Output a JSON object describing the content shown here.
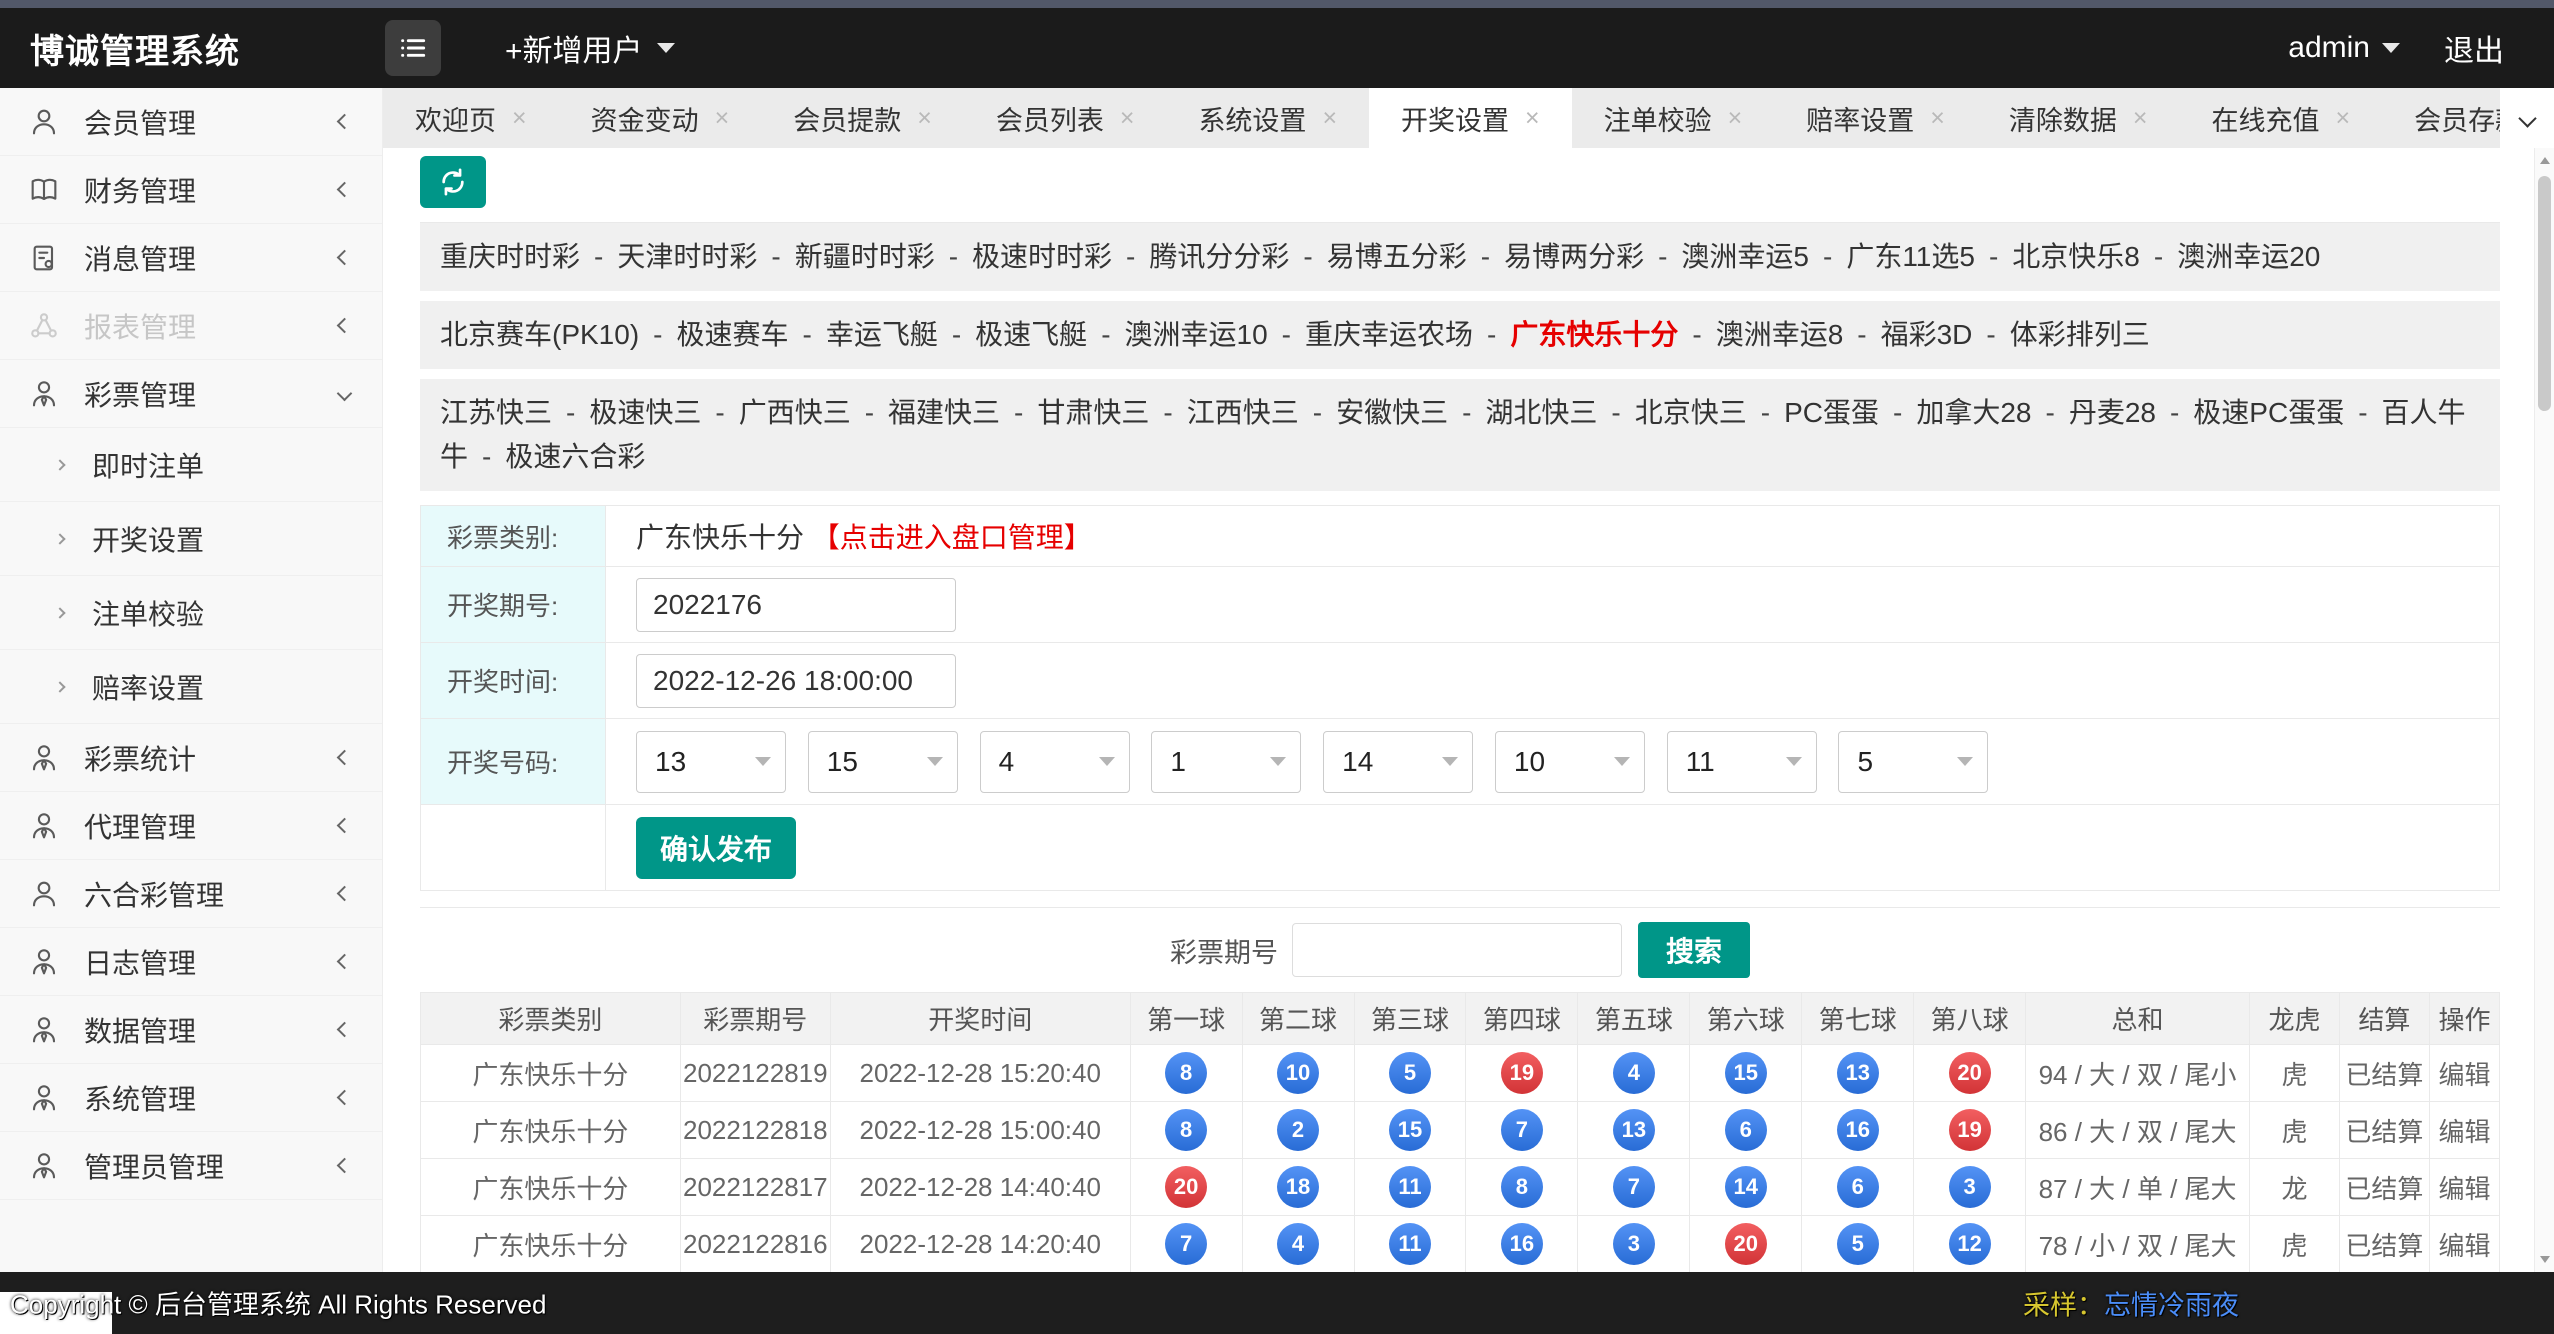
{
  "topbar": {
    "title": "博诚管理系统",
    "add_user": "+新增用户",
    "username": "admin",
    "logout": "退出"
  },
  "tabs": {
    "items": [
      "欢迎页",
      "资金变动",
      "会员提款",
      "会员列表",
      "系统设置",
      "开奖设置",
      "注单校验",
      "赔率设置",
      "清除数据",
      "在线充值",
      "会员存款"
    ],
    "active": "开奖设置"
  },
  "sidebar": {
    "items": [
      {
        "label": "会员管理",
        "icon": "user"
      },
      {
        "label": "财务管理",
        "icon": "book"
      },
      {
        "label": "消息管理",
        "icon": "document"
      },
      {
        "label": "报表管理",
        "icon": "share",
        "disabled": true
      },
      {
        "label": "彩票管理",
        "icon": "user-tie",
        "expanded": true
      },
      {
        "label": "即时注单",
        "sub": true
      },
      {
        "label": "开奖设置",
        "sub": true
      },
      {
        "label": "注单校验",
        "sub": true
      },
      {
        "label": "赔率设置",
        "sub": true
      },
      {
        "label": "彩票统计",
        "icon": "user-tie"
      },
      {
        "label": "代理管理",
        "icon": "user-tie"
      },
      {
        "label": "六合彩管理",
        "icon": "user"
      },
      {
        "label": "日志管理",
        "icon": "user-tie"
      },
      {
        "label": "数据管理",
        "icon": "user-tie"
      },
      {
        "label": "系统管理",
        "icon": "user-tie"
      },
      {
        "label": "管理员管理",
        "icon": "user-tie"
      }
    ]
  },
  "lottery": {
    "active": "广东快乐十分",
    "rows": [
      {
        "items": [
          "重庆时时彩",
          "天津时时彩",
          "新疆时时彩",
          "极速时时彩",
          "腾讯分分彩",
          "易博五分彩",
          "易博两分彩",
          "澳洲幸运5",
          "广东11选5",
          "北京快乐8",
          "澳洲幸运20"
        ]
      },
      {
        "items": [
          "北京赛车(PK10)",
          "极速赛车",
          "幸运飞艇",
          "极速飞艇",
          "澳洲幸运10",
          "重庆幸运农场",
          "广东快乐十分",
          "澳洲幸运8",
          "福彩3D",
          "体彩排列三"
        ]
      },
      {
        "items": [
          "江苏快三",
          "极速快三",
          "广西快三",
          "福建快三",
          "甘肃快三",
          "江西快三",
          "安徽快三",
          "湖北快三",
          "北京快三",
          "PC蛋蛋",
          "加拿大28",
          "丹麦28",
          "极速PC蛋蛋",
          "百人牛牛",
          "极速六合彩"
        ]
      }
    ]
  },
  "form": {
    "category_label": "彩票类别:",
    "category_value": "广东快乐十分",
    "category_link": "【点击进入盘口管理】",
    "issue_label": "开奖期号:",
    "issue_value": "2022176",
    "time_label": "开奖时间:",
    "time_value": "2022-12-26 18:00:00",
    "numbers_label": "开奖号码:",
    "numbers": [
      "13",
      "15",
      "4",
      "1",
      "14",
      "10",
      "11",
      "5"
    ],
    "submit_label": "确认发布"
  },
  "search": {
    "label": "彩票期号",
    "value": "",
    "button": "搜索"
  },
  "table": {
    "headers": [
      "彩票类别",
      "彩票期号",
      "开奖时间",
      "第一球",
      "第二球",
      "第三球",
      "第四球",
      "第五球",
      "第六球",
      "第七球",
      "第八球",
      "总和",
      "龙虎",
      "结算",
      "操作"
    ],
    "rows": [
      {
        "type": "广东快乐十分",
        "issue": "2022122819",
        "time": "2022-12-28 15:20:40",
        "balls": [
          {
            "v": "8",
            "color": "#2e7bf3"
          },
          {
            "v": "10",
            "color": "#2e7bf3"
          },
          {
            "v": "5",
            "color": "#2e7bf3"
          },
          {
            "v": "19",
            "color": "#ef3b3e"
          },
          {
            "v": "4",
            "color": "#2e7bf3"
          },
          {
            "v": "15",
            "color": "#2e7bf3"
          },
          {
            "v": "13",
            "color": "#2e7bf3"
          },
          {
            "v": "20",
            "color": "#ef3b3e"
          }
        ],
        "sum": "94 / 大 / 双 / 尾小",
        "dragon_tiger": "虎",
        "status": "已结算",
        "action": "编辑"
      },
      {
        "type": "广东快乐十分",
        "issue": "2022122818",
        "time": "2022-12-28 15:00:40",
        "balls": [
          {
            "v": "8",
            "color": "#2e7bf3"
          },
          {
            "v": "2",
            "color": "#2e7bf3"
          },
          {
            "v": "15",
            "color": "#2e7bf3"
          },
          {
            "v": "7",
            "color": "#2e7bf3"
          },
          {
            "v": "13",
            "color": "#2e7bf3"
          },
          {
            "v": "6",
            "color": "#2e7bf3"
          },
          {
            "v": "16",
            "color": "#2e7bf3"
          },
          {
            "v": "19",
            "color": "#ef3b3e"
          }
        ],
        "sum": "86 / 大 / 双 / 尾大",
        "dragon_tiger": "虎",
        "status": "已结算",
        "action": "编辑"
      },
      {
        "type": "广东快乐十分",
        "issue": "2022122817",
        "time": "2022-12-28 14:40:40",
        "balls": [
          {
            "v": "20",
            "color": "#ef3b3e"
          },
          {
            "v": "18",
            "color": "#2e7bf3"
          },
          {
            "v": "11",
            "color": "#2e7bf3"
          },
          {
            "v": "8",
            "color": "#2e7bf3"
          },
          {
            "v": "7",
            "color": "#2e7bf3"
          },
          {
            "v": "14",
            "color": "#2e7bf3"
          },
          {
            "v": "6",
            "color": "#2e7bf3"
          },
          {
            "v": "3",
            "color": "#2e7bf3"
          }
        ],
        "sum": "87 / 大 / 单 / 尾大",
        "dragon_tiger": "龙",
        "status": "已结算",
        "action": "编辑"
      },
      {
        "type": "广东快乐十分",
        "issue": "2022122816",
        "time": "2022-12-28 14:20:40",
        "balls": [
          {
            "v": "7",
            "color": "#2e7bf3"
          },
          {
            "v": "4",
            "color": "#2e7bf3"
          },
          {
            "v": "11",
            "color": "#2e7bf3"
          },
          {
            "v": "16",
            "color": "#2e7bf3"
          },
          {
            "v": "3",
            "color": "#2e7bf3"
          },
          {
            "v": "20",
            "color": "#ef3b3e"
          },
          {
            "v": "5",
            "color": "#2e7bf3"
          },
          {
            "v": "12",
            "color": "#2e7bf3"
          }
        ],
        "sum": "78 / 小 / 双 / 尾大",
        "dragon_tiger": "虎",
        "status": "已结算",
        "action": "编辑"
      }
    ]
  },
  "footer": {
    "copyright": "Copyright © 后台管理系统 All Rights Reserved",
    "sample_label": "采样：",
    "sample_link": "忘情冷雨夜"
  },
  "colors": {
    "accent": "#009688",
    "ball_blue": "#2e7bf3",
    "ball_red": "#ef3b3e",
    "highlight_red": "#e60000"
  }
}
